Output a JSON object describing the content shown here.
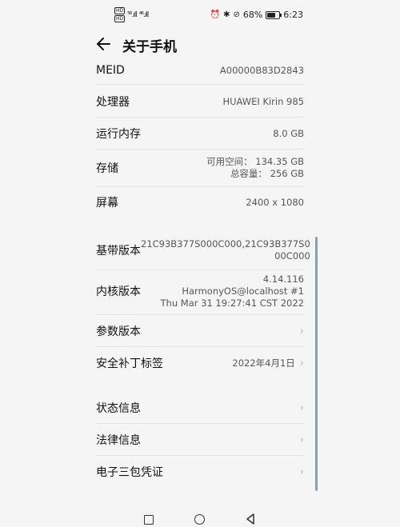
{
  "status_bar": {
    "sim_badges": [
      "HD",
      "HD"
    ],
    "signal_1": "⁵⁶.ıll",
    "signal_2": "⁴⁶.ıll",
    "icons": [
      "alarm-icon",
      "bluetooth-icon",
      "nfc-icon"
    ],
    "battery_percent": "68%",
    "battery_level": 0.68,
    "time": "6:23"
  },
  "header": {
    "title": "关于手机"
  },
  "rows": [
    {
      "label": "MEID",
      "value": "A00000B83D2843"
    },
    {
      "label": "处理器",
      "value": "HUAWEI Kirin 985"
    },
    {
      "label": "运行内存",
      "value": "8.0 GB"
    },
    {
      "label": "存储",
      "value_lines": [
        "可用空间： 134.35 GB",
        "总容量： 256 GB"
      ]
    },
    {
      "label": "屏幕",
      "value": "2400 x 1080"
    },
    {
      "label": "基带版本",
      "value_lines": [
        "21C93B377S000C000,21C93B377S0",
        "00C000"
      ]
    },
    {
      "label": "内核版本",
      "value_lines": [
        "4.14.116",
        "HarmonyOS@localhost #1",
        "Thu Mar 31 19:27:41 CST 2022"
      ]
    },
    {
      "label": "参数版本",
      "value": ""
    },
    {
      "label": "安全补丁标签",
      "value": "2022年4月1日"
    },
    {
      "label": "状态信息",
      "value": ""
    },
    {
      "label": "法律信息",
      "value": ""
    },
    {
      "label": "电子三包凭证",
      "value": ""
    }
  ],
  "colors": {
    "scrollbar": "#8aa1ad",
    "divider": "#e2e2e2",
    "background": "#f5f5f5"
  },
  "navbar": {
    "icons": [
      "recent-apps-icon",
      "home-icon",
      "back-icon"
    ]
  }
}
